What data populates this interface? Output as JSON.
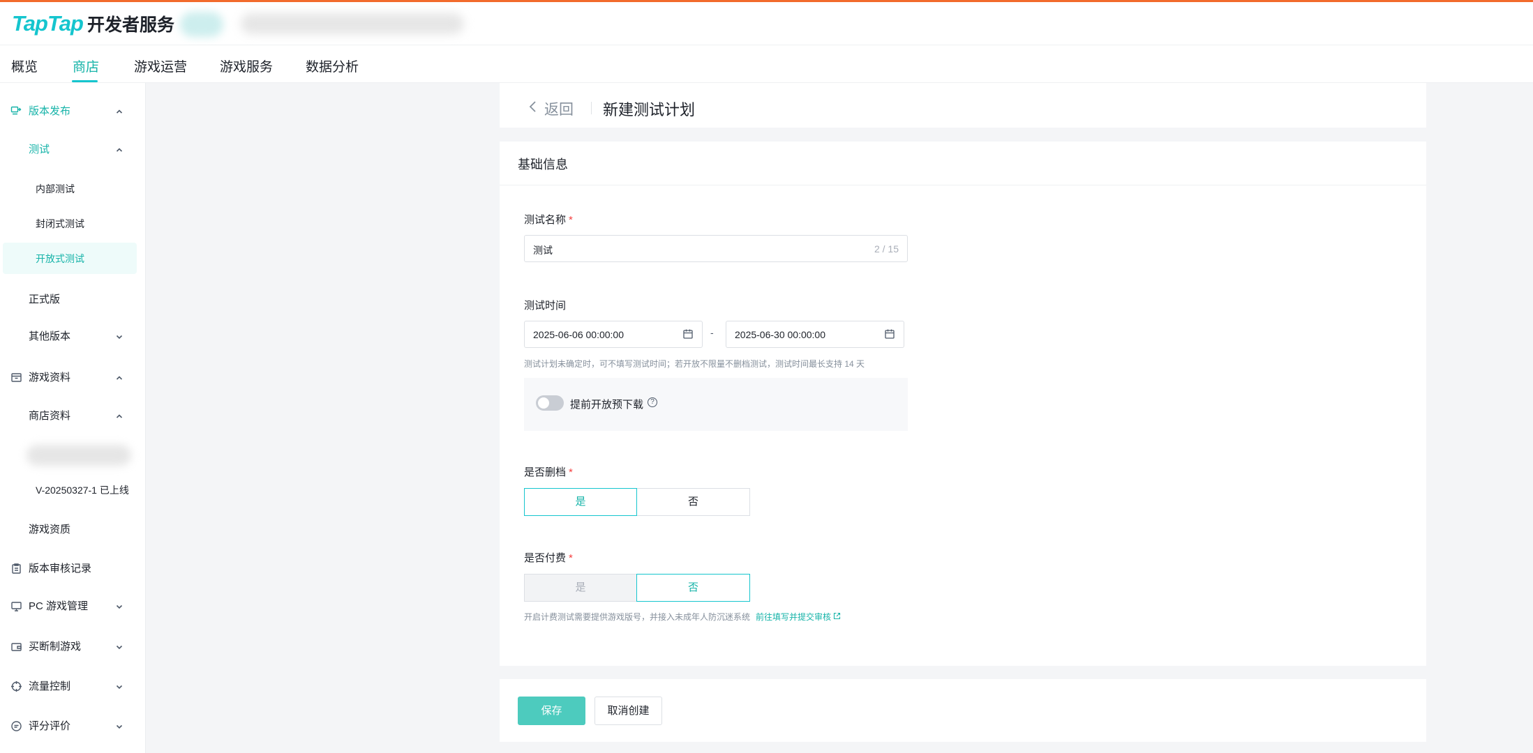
{
  "header": {
    "logo_brand": "TapTap",
    "logo_service": "开发者服务"
  },
  "nav": {
    "tabs": [
      {
        "label": "概览"
      },
      {
        "label": "商店"
      },
      {
        "label": "游戏运营"
      },
      {
        "label": "游戏服务"
      },
      {
        "label": "数据分析"
      }
    ],
    "active": "商店"
  },
  "sidebar": {
    "release": "版本发布",
    "test": "测试",
    "internal_test": "内部测试",
    "closed_test": "封闭式测试",
    "open_test": "开放式测试",
    "official": "正式版",
    "other_versions": "其他版本",
    "game_info": "游戏资料",
    "store_info": "商店资料",
    "version_entry": "V-20250327-1 已上线",
    "qualification": "游戏资质",
    "review_record": "版本审核记录",
    "pc_manage": "PC 游戏管理",
    "buyout": "买断制游戏",
    "traffic": "流量控制",
    "rating": "评分评价"
  },
  "page": {
    "back_label": "返回",
    "title": "新建测试计划"
  },
  "form": {
    "section_title": "基础信息",
    "name_label": "测试名称",
    "name_value": "测试",
    "name_count": "2 / 15",
    "time_label": "测试时间",
    "start_time": "2025-06-06 00:00:00",
    "end_time": "2025-06-30 00:00:00",
    "time_separator": "-",
    "time_hint": "测试计划未确定时，可不填写测试时间；若开放不限量不删档测试，测试时间最长支持 14 天",
    "preload_label": "提前开放预下载",
    "preload_on": false,
    "wipe_label": "是否删档",
    "wipe_yes": "是",
    "wipe_no": "否",
    "wipe_selected": "是",
    "paid_label": "是否付费",
    "paid_yes": "是",
    "paid_no": "否",
    "paid_selected": "否",
    "paid_hint": "开启计费测试需要提供游戏版号，并接入未成年人防沉迷系统",
    "paid_link": "前往填写并提交审核",
    "required_mark": "*"
  },
  "actions": {
    "save": "保存",
    "cancel": "取消创建"
  },
  "colors": {
    "accent": "#15c5ce",
    "accent_text": "#15b3a8",
    "primary_button": "#4dcbbe",
    "top_border": "#f26b2c",
    "required": "#f53f3f"
  }
}
